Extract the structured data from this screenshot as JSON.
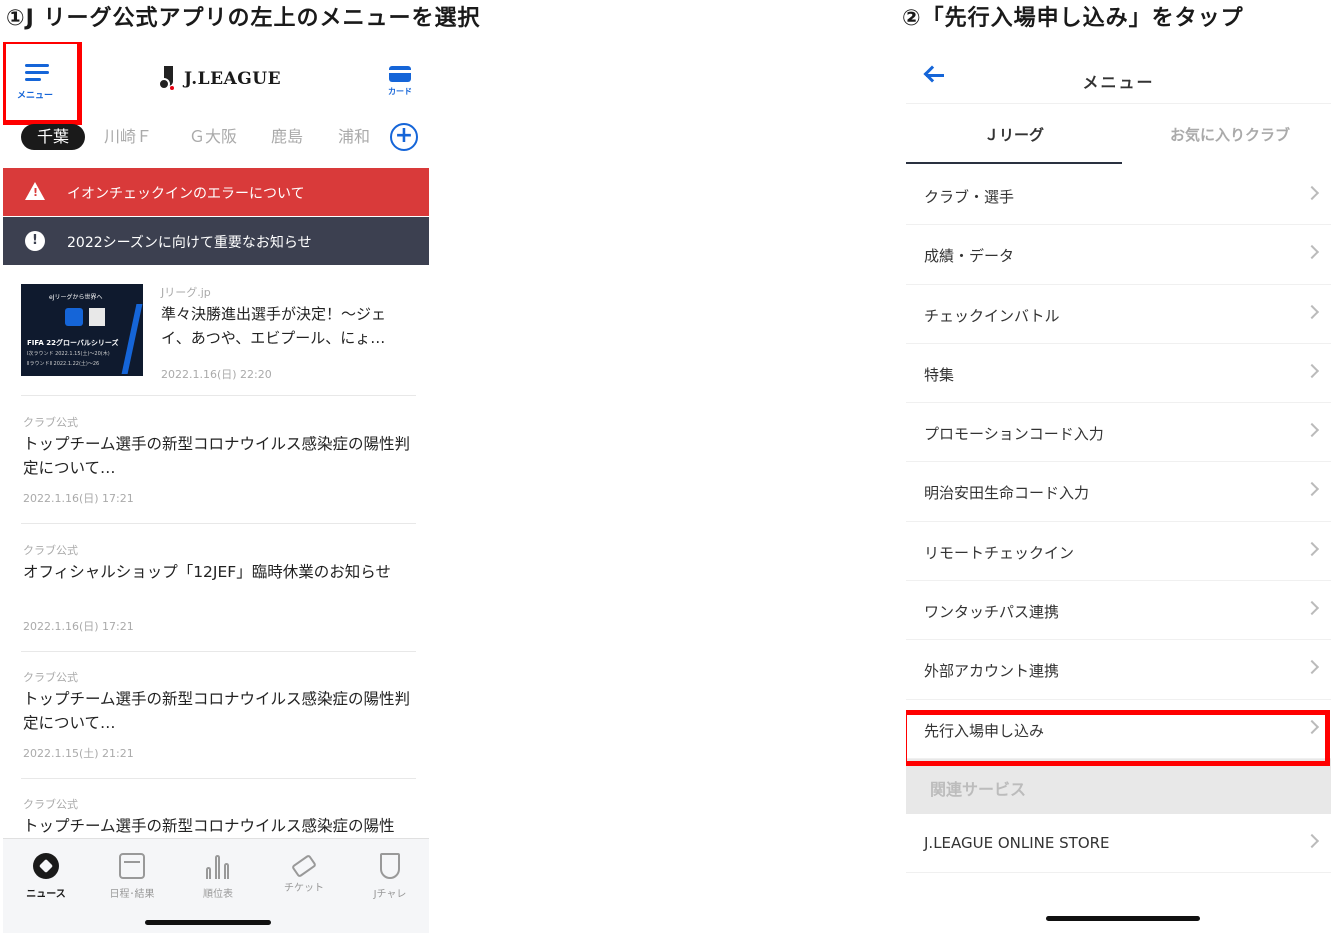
{
  "captions": {
    "step1": "①J リーグ公式アプリの左上のメニューを選択",
    "step2": "②「先行入場申し込み」をタップ"
  },
  "left": {
    "header": {
      "menu_label": "メニュー",
      "logo_text": "J.LEAGUE",
      "card_label": "カード"
    },
    "club_tabs": [
      "千葉",
      "川崎Ｆ",
      "Ｇ大阪",
      "鹿島",
      "浦和"
    ],
    "alerts": [
      {
        "text": "イオンチェックインのエラーについて",
        "color": "#d93a3a"
      },
      {
        "text": "2022シーズンに向けて重要なお知らせ",
        "color": "#3c4050"
      }
    ],
    "news_top": {
      "source": "Jリーグ.jp",
      "title": "準々決勝進出選手が決定！〜ジェイ、あつや、エビプール、にょ…",
      "date": "2022.1.16(日) 22:20",
      "thumb_text1": "eJリーグから世界へ",
      "thumb_text2": "FIFA 22グローバルシリーズ",
      "thumb_text3": "Ⅰ次ラウンド 2022.1.15(土)〜20(木)",
      "thumb_text4": "ⅡラウンドⅡ 2022.1.22(土)〜26"
    },
    "news": [
      {
        "source": "クラブ公式",
        "title": "トップチーム選手の新型コロナウイルス感染症の陽性判定について…",
        "date": "2022.1.16(日) 17:21"
      },
      {
        "source": "クラブ公式",
        "title": "オフィシャルショップ「12JEF」臨時休業のお知らせ",
        "date": "2022.1.16(日) 17:21"
      },
      {
        "source": "クラブ公式",
        "title": "トップチーム選手の新型コロナウイルス感染症の陽性判定について…",
        "date": "2022.1.15(土) 21:21"
      },
      {
        "source": "クラブ公式",
        "title": "トップチーム選手の新型コロナウイルス感染症の陽性",
        "date": ""
      }
    ],
    "bottom_nav": [
      {
        "label": "ニュース",
        "icon": "soccer-ball-icon"
      },
      {
        "label": "日程･結果",
        "icon": "calendar-icon"
      },
      {
        "label": "順位表",
        "icon": "ranking-icon"
      },
      {
        "label": "チケット",
        "icon": "ticket-icon"
      },
      {
        "label": "Jチャレ",
        "icon": "trophy-icon"
      }
    ]
  },
  "right": {
    "title": "メニュー",
    "tabs": [
      "Ｊリーグ",
      "お気に入りクラブ"
    ],
    "items": [
      "クラブ・選手",
      "成績・データ",
      "チェックインバトル",
      "特集",
      "プロモーションコード入力",
      "明治安田生命コード入力",
      "リモートチェックイン",
      "ワンタッチパス連携",
      "外部アカウント連携",
      "先行入場申し込み"
    ],
    "section_header": "関連サービス",
    "store_item": "J.LEAGUE ONLINE STORE"
  },
  "colors": {
    "accent": "#1565d8",
    "highlight": "#ff0000"
  }
}
